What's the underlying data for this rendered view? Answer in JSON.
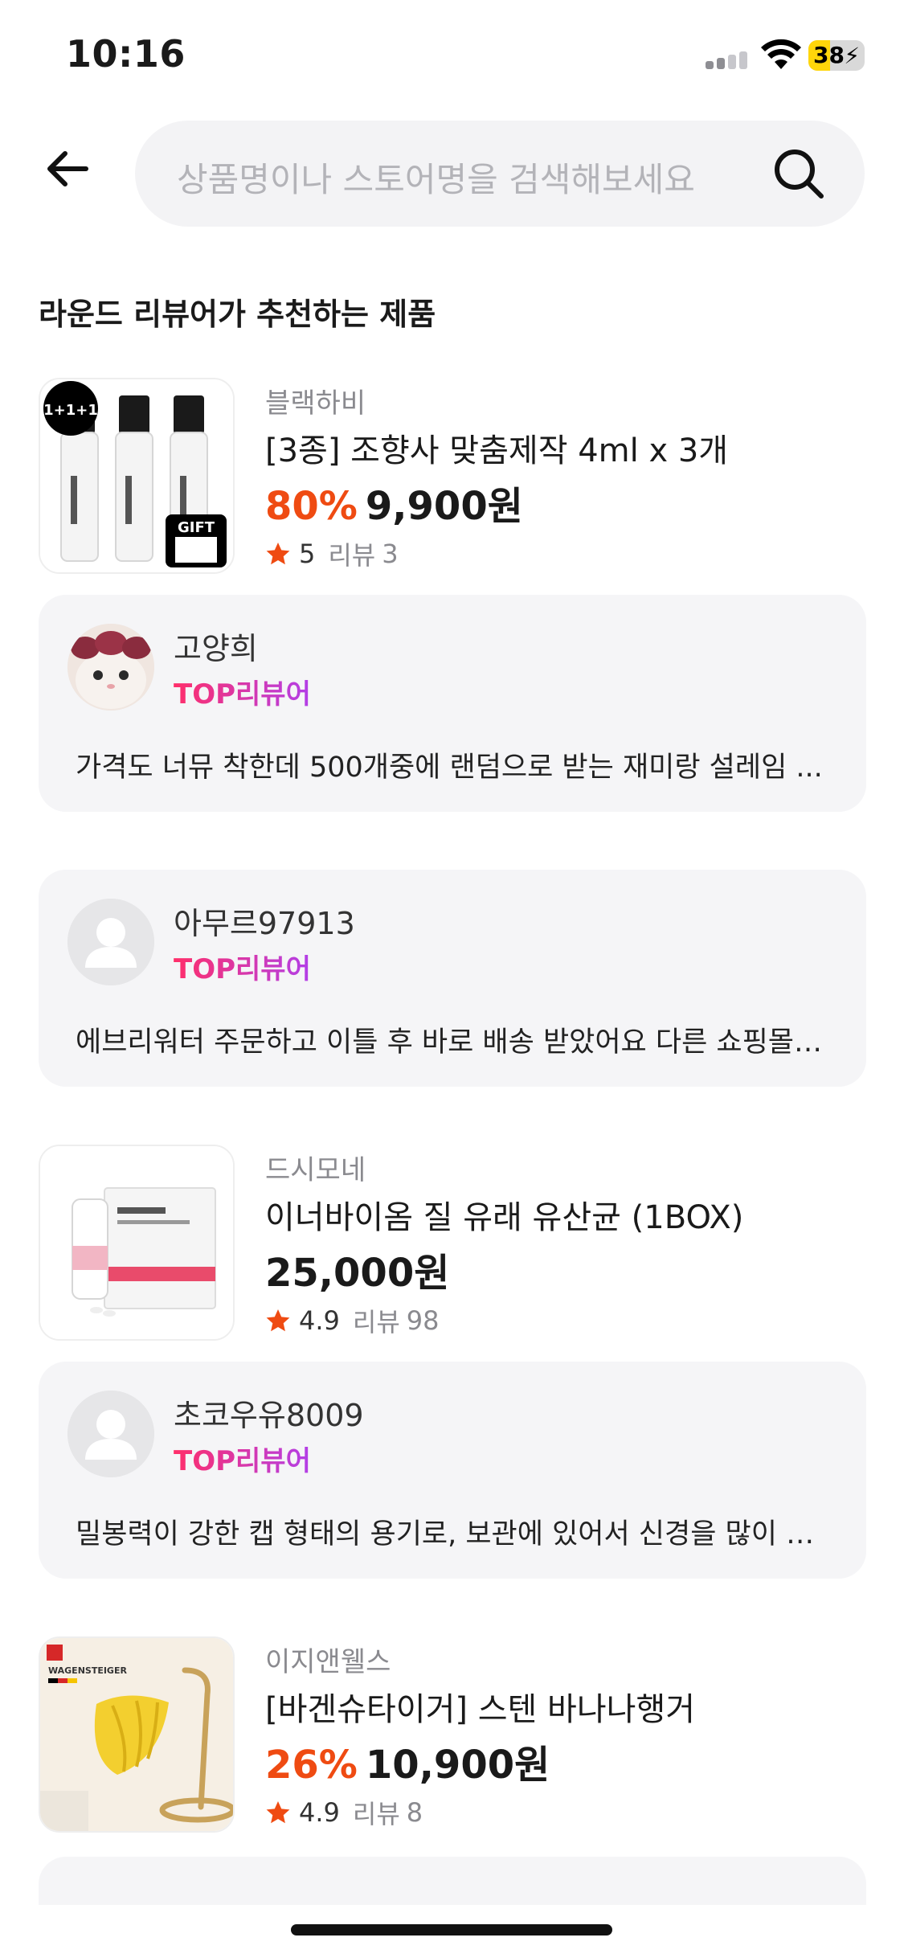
{
  "status_bar": {
    "time": "10:16",
    "battery": "38",
    "battery_level": 0.38,
    "battery_color": "#ffd60a"
  },
  "header": {
    "back_icon": "arrow-left-icon",
    "search_placeholder": "상품명이나 스토어명을 검색해보세요",
    "search_icon": "search-icon"
  },
  "section_title": "라운드 리뷰어가 추천하는 제품",
  "review_label": "리뷰",
  "colors": {
    "discount": "#ef4b12",
    "star": "#ef4b12",
    "badge_from": "#ff2f6a",
    "badge_to": "#b23fe8"
  },
  "products": [
    {
      "store": "블랙하비",
      "name": "[3종] 조향사 맞춤제작 4ml x 3개",
      "discount": "80%",
      "price": "9,900원",
      "rating": "5",
      "reviews": "3",
      "badge": "1+1+1",
      "gift": "GIFT"
    },
    {
      "store": "드시모네",
      "name": "이너바이옴 질 유래 유산균 (1BOX)",
      "discount": "",
      "price": "25,000원",
      "rating": "4.9",
      "reviews": "98"
    },
    {
      "store": "이지앤웰스",
      "name": "[바겐슈타이거] 스텐 바나나행거",
      "discount": "26%",
      "price": "10,900원",
      "rating": "4.9",
      "reviews": "8",
      "brand": "WAGENSTEIGER"
    }
  ],
  "reviews": [
    {
      "name": "고양희",
      "badge": "TOP리뷰어",
      "text": "가격도 너뮤 착한데 500개중에 랜덤으로 받는 재미랑 설레임 ..."
    },
    {
      "name": "아무르97913",
      "badge": "TOP리뷰어",
      "text": "에브리워터 주문하고 이틀 후 바로 배송 받았어요 다른 쇼핑몰에..."
    },
    {
      "name": "초코우유8009",
      "badge": "TOP리뷰어",
      "text": "밀봉력이 강한 캡 형태의 용기로, 보관에 있어서 신경을 많이 쓴 ..."
    }
  ]
}
